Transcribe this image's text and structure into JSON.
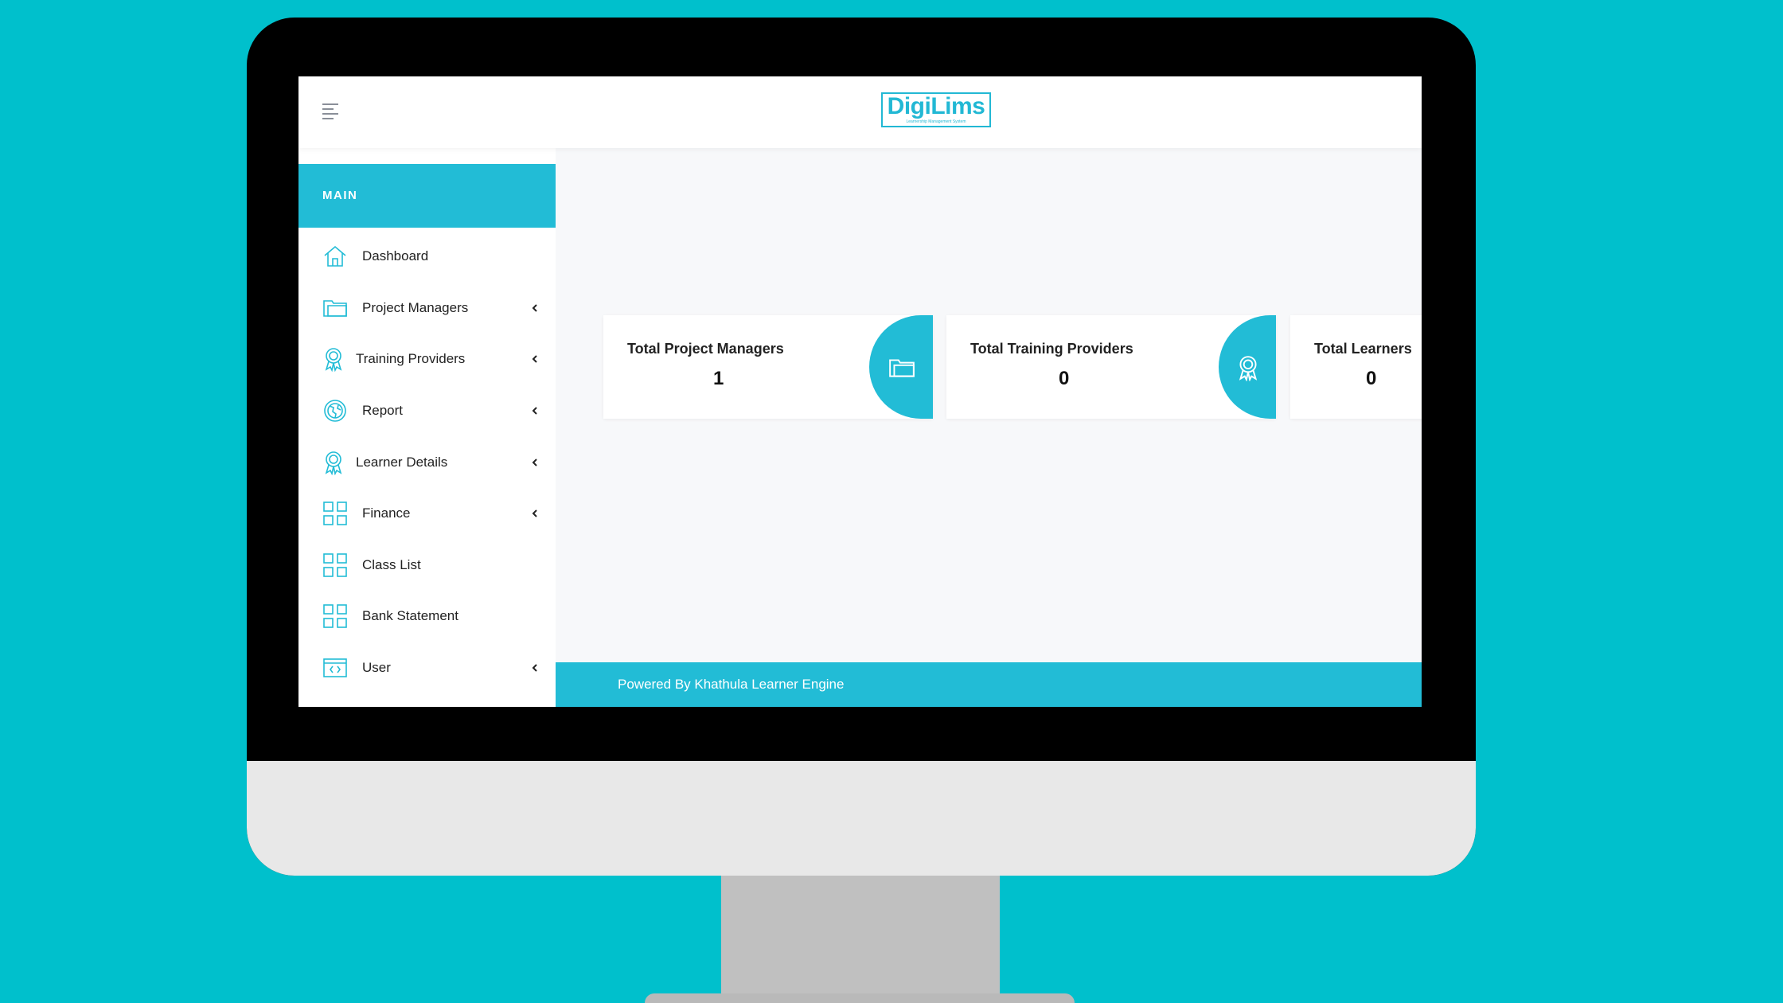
{
  "app": {
    "logo_text": "DigiLims",
    "logo_subtext": "Learnership Management System"
  },
  "sidebar": {
    "section_label": "MAIN",
    "items": [
      {
        "label": "Dashboard",
        "icon": "home-icon",
        "has_submenu": false
      },
      {
        "label": "Project Managers",
        "icon": "folder-icon",
        "has_submenu": true
      },
      {
        "label": "Training Providers",
        "icon": "award-icon",
        "has_submenu": true
      },
      {
        "label": "Report",
        "icon": "globe-icon",
        "has_submenu": true
      },
      {
        "label": "Learner Details",
        "icon": "award-icon",
        "has_submenu": true
      },
      {
        "label": "Finance",
        "icon": "grid-icon",
        "has_submenu": true
      },
      {
        "label": "Class List",
        "icon": "grid-icon",
        "has_submenu": false
      },
      {
        "label": "Bank Statement",
        "icon": "grid-icon",
        "has_submenu": false
      },
      {
        "label": "User",
        "icon": "code-window-icon",
        "has_submenu": true
      }
    ]
  },
  "cards": [
    {
      "title": "Total Project Managers",
      "value": "1",
      "icon": "folder-icon"
    },
    {
      "title": "Total Training Providers",
      "value": "0",
      "icon": "award-icon"
    },
    {
      "title": "Total Learners",
      "value": "0",
      "icon": "award-icon"
    }
  ],
  "footer": {
    "text": "Powered By Khathula Learner Engine"
  },
  "colors": {
    "background": "#00c0cc",
    "accent": "#22bcd6",
    "sidebar_bg": "#ffffff",
    "content_bg": "#f7f8fa"
  }
}
